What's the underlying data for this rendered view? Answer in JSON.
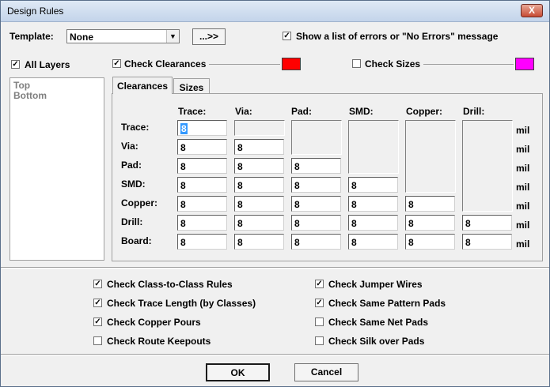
{
  "window": {
    "title": "Design Rules",
    "close_glyph": "X"
  },
  "template": {
    "label": "Template:",
    "value": "None",
    "arrow_glyph": "▼",
    "button_label": "...>>"
  },
  "show_errors": {
    "checked": true,
    "label": "Show a list of errors or \"No Errors\" message"
  },
  "all_layers": {
    "checked": true,
    "label": "All Layers"
  },
  "layers": [
    "Top",
    "Bottom"
  ],
  "check_clearances": {
    "checked": true,
    "label": "Check Clearances",
    "color": "#ff0000"
  },
  "check_sizes": {
    "checked": false,
    "label": "Check Sizes",
    "color": "#ff00ff"
  },
  "tabs": [
    {
      "label": "Clearances",
      "active": true
    },
    {
      "label": "Sizes",
      "active": false
    }
  ],
  "clearances": {
    "columns": [
      "Trace:",
      "Via:",
      "Pad:",
      "SMD:",
      "Copper:",
      "Drill:"
    ],
    "rows": [
      {
        "label": "Trace:",
        "values": [
          "8"
        ]
      },
      {
        "label": "Via:",
        "values": [
          "8",
          "8"
        ]
      },
      {
        "label": "Pad:",
        "values": [
          "8",
          "8",
          "8"
        ]
      },
      {
        "label": "SMD:",
        "values": [
          "8",
          "8",
          "8",
          "8"
        ]
      },
      {
        "label": "Copper:",
        "values": [
          "8",
          "8",
          "8",
          "8",
          "8"
        ]
      },
      {
        "label": "Drill:",
        "values": [
          "8",
          "8",
          "8",
          "8",
          "8",
          "8"
        ]
      },
      {
        "label": "Board:",
        "values": [
          "8",
          "8",
          "8",
          "8",
          "8",
          "8"
        ]
      }
    ],
    "unit": "mil"
  },
  "checks_left": [
    {
      "label": "Check Class-to-Class Rules",
      "checked": true
    },
    {
      "label": "Check Trace Length (by Classes)",
      "checked": true
    },
    {
      "label": "Check Copper Pours",
      "checked": true
    },
    {
      "label": "Check Route Keepouts",
      "checked": false
    }
  ],
  "checks_right": [
    {
      "label": "Check Jumper Wires",
      "checked": true
    },
    {
      "label": "Check Same Pattern Pads",
      "checked": true
    },
    {
      "label": "Check Same Net Pads",
      "checked": false
    },
    {
      "label": "Check Silk over Pads",
      "checked": false
    }
  ],
  "buttons": {
    "ok": "OK",
    "cancel": "Cancel"
  },
  "check_glyph": "✓"
}
